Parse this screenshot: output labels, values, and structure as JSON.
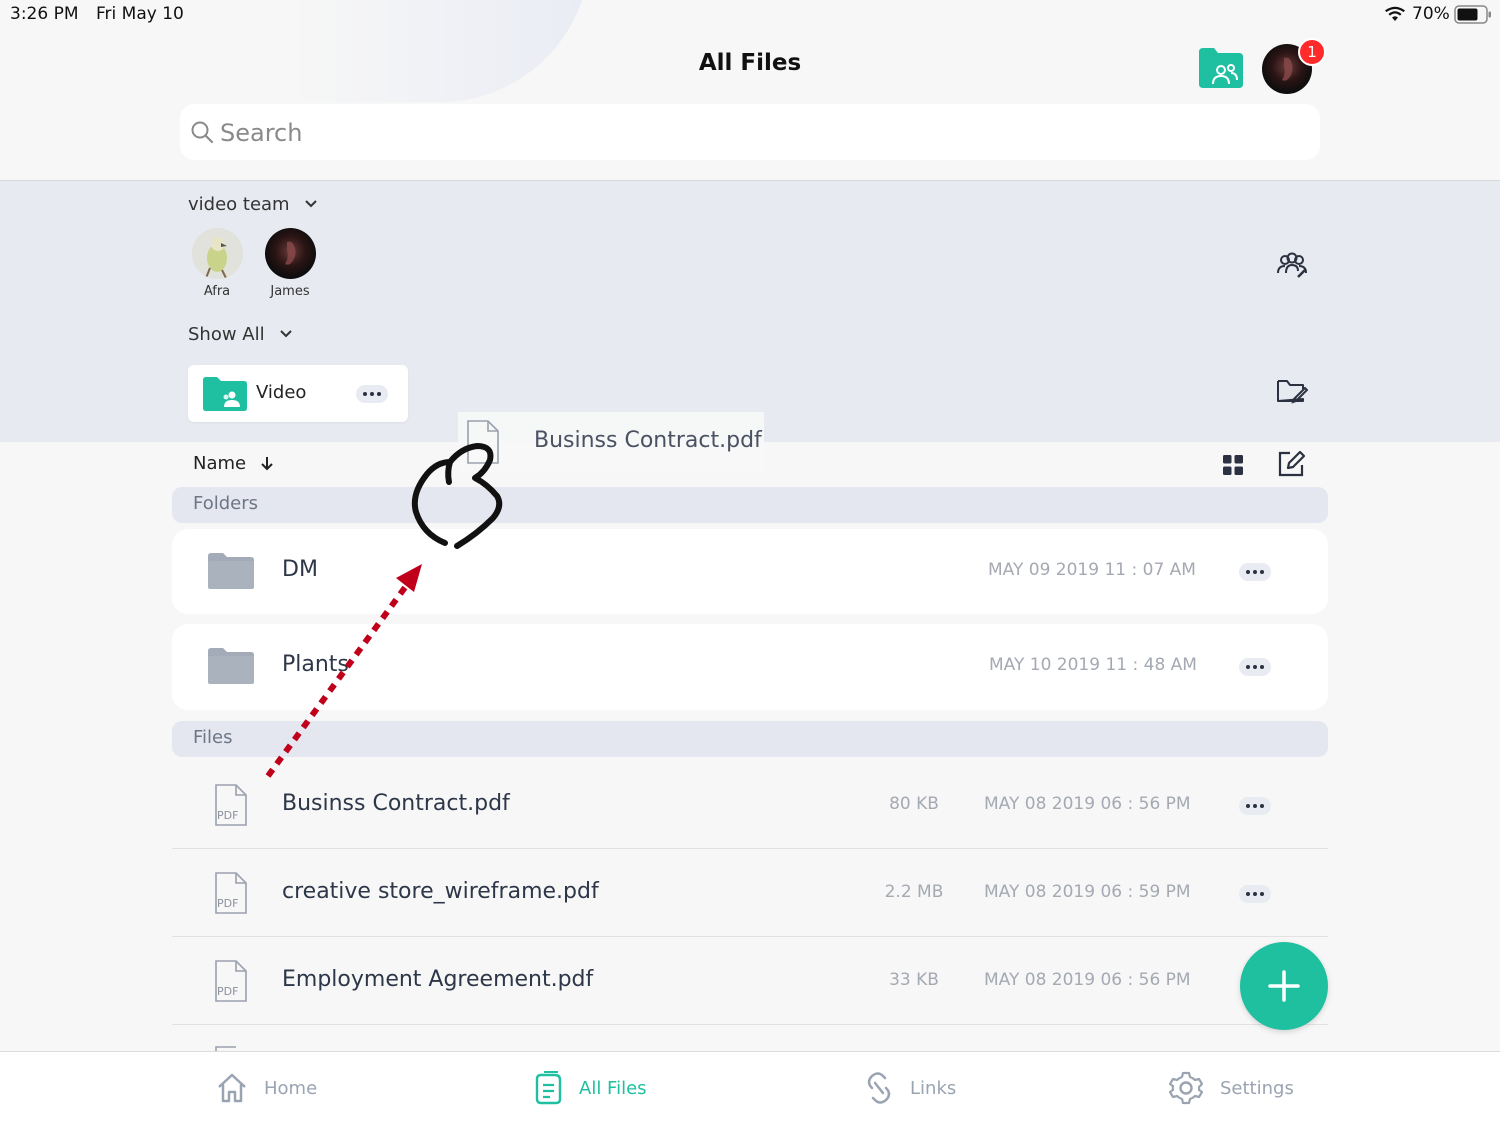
{
  "status_bar": {
    "time": "3:26 PM",
    "date": "Fri May 10",
    "battery": "70%"
  },
  "header": {
    "title": "All Files",
    "notification_count": "1"
  },
  "search": {
    "placeholder": "Search"
  },
  "team": {
    "name": "video team",
    "members": [
      {
        "name": "Afra"
      },
      {
        "name": "James"
      }
    ],
    "show_all_label": "Show All",
    "team_folder": {
      "name": "Video"
    }
  },
  "drag_preview": {
    "file_name": "Businss Contract.pdf"
  },
  "sort": {
    "label": "Name"
  },
  "sections": {
    "folders_label": "Folders",
    "files_label": "Files"
  },
  "folders": [
    {
      "name": "DM",
      "date": "MAY 09 2019 11 : 07 AM"
    },
    {
      "name": "Plants",
      "date": "MAY 10 2019 11 : 48 AM"
    }
  ],
  "files": [
    {
      "name": "Businss Contract.pdf",
      "size": "80 KB",
      "date": "MAY 08 2019 06 : 56 PM",
      "type_badge": "PDF"
    },
    {
      "name": "creative store_wireframe.pdf",
      "size": "2.2 MB",
      "date": "MAY 08 2019 06 : 59 PM",
      "type_badge": "PDF"
    },
    {
      "name": "Employment Agreement.pdf",
      "size": "33 KB",
      "date": "MAY 08 2019 06 : 56 PM",
      "type_badge": "PDF"
    }
  ],
  "tabs": [
    {
      "label": "Home"
    },
    {
      "label": "All Files"
    },
    {
      "label": "Links"
    },
    {
      "label": "Settings"
    }
  ],
  "colors": {
    "accent": "#1ec0a1",
    "badge": "#ff2a2a",
    "drag_arrow": "#c0001a",
    "folder_gray": "#a3abb8"
  },
  "icons": [
    "search-icon",
    "team-folder-icon",
    "avatar",
    "chevron-down-icon",
    "manage-members-icon",
    "edit-folder-icon",
    "grid-view-icon",
    "edit-icon",
    "sort-arrow-icon",
    "folder-icon",
    "pdf-file-icon",
    "more-icon",
    "plus-icon",
    "home-icon",
    "all-files-icon",
    "links-icon",
    "settings-icon",
    "wifi-icon",
    "battery-icon",
    "hand-drag-icon"
  ]
}
